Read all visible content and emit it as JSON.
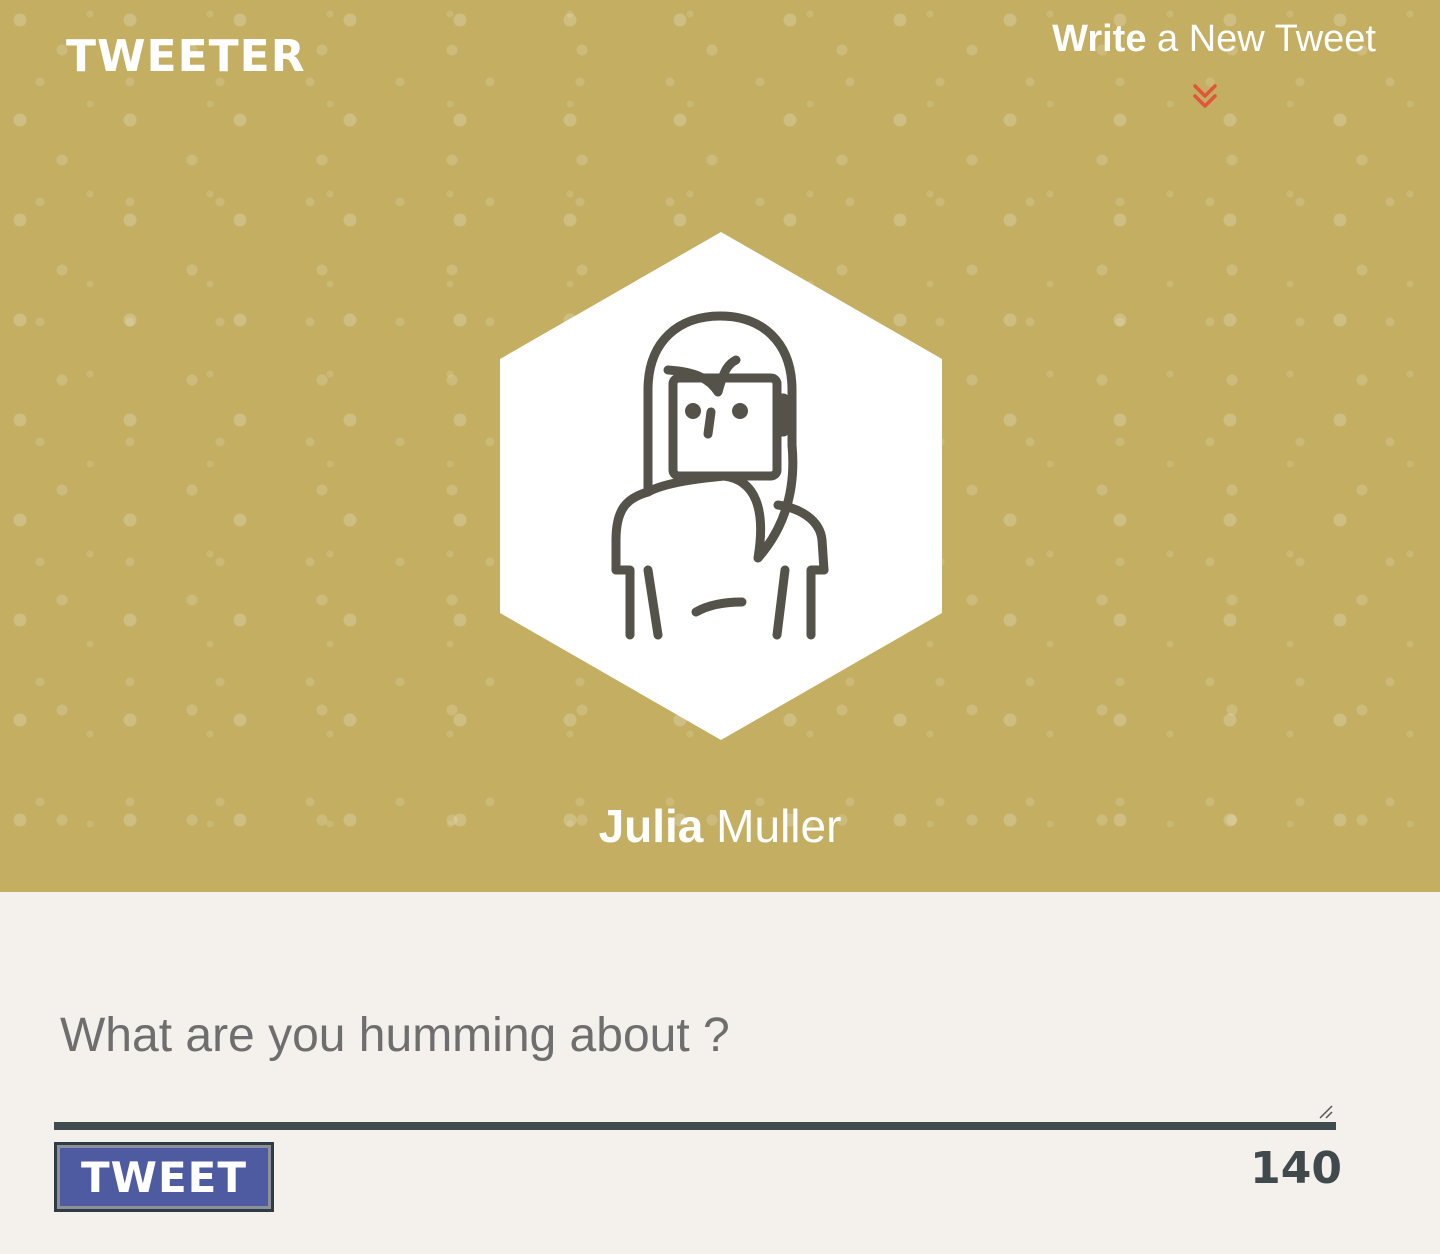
{
  "app": {
    "brand": "TWEETER"
  },
  "nav": {
    "compose_bold": "Write",
    "compose_rest": " a New Tweet",
    "chevron_icon": "double-chevron-down-icon"
  },
  "profile": {
    "first_name": "Julia",
    "last_name": " Muller",
    "avatar_icon": "woman-avatar-icon"
  },
  "composer": {
    "placeholder": "What are you humming about ?",
    "value": ""
  },
  "actions": {
    "tweet_label": "TWEET",
    "char_counter": "140"
  },
  "colors": {
    "hero_background": "#c3ae62",
    "page_background": "#f4f1ed",
    "chevron": "#e2553a",
    "button": "#4e5ba1",
    "underline": "#3f4d4f",
    "avatar_stroke": "#55524a"
  }
}
